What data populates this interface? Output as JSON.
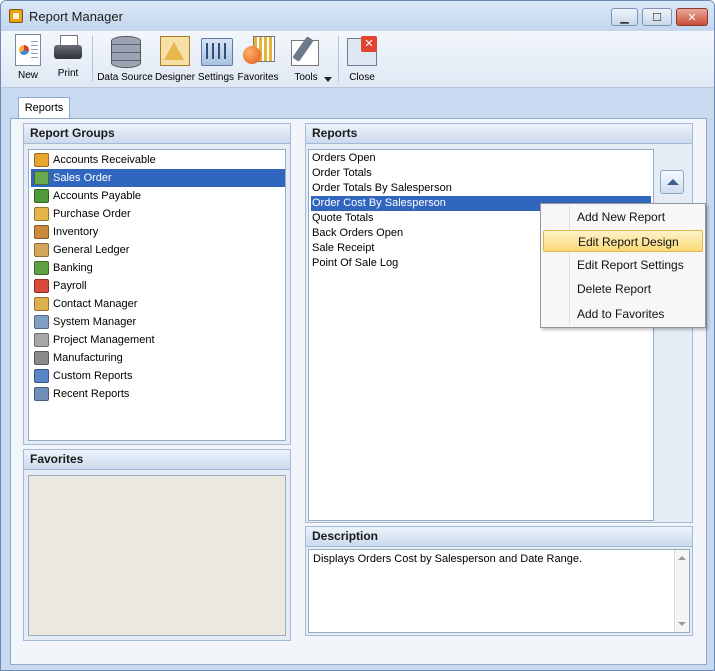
{
  "window": {
    "title": "Report Manager"
  },
  "toolbar": {
    "buttons": [
      {
        "label": "New",
        "icon": "new-report-icon"
      },
      {
        "label": "Print",
        "icon": "printer-icon"
      },
      {
        "label": "Data Source",
        "icon": "database-icon"
      },
      {
        "label": "Designer",
        "icon": "designer-icon"
      },
      {
        "label": "Settings",
        "icon": "settings-icon"
      },
      {
        "label": "Favorites",
        "icon": "favorites-icon"
      },
      {
        "label": "Tools",
        "icon": "tools-icon"
      },
      {
        "label": "Close",
        "icon": "close-window-icon"
      }
    ]
  },
  "tabs": [
    {
      "label": "Reports"
    }
  ],
  "report_groups": {
    "header": "Report Groups",
    "items": [
      {
        "label": "Accounts Receivable",
        "color": "#e8a62c"
      },
      {
        "label": "Sales Order",
        "color": "#6aa84f",
        "selected": true
      },
      {
        "label": "Accounts Payable",
        "color": "#4f9a3a"
      },
      {
        "label": "Purchase Order",
        "color": "#e5b54a"
      },
      {
        "label": "Inventory",
        "color": "#c98a3a"
      },
      {
        "label": "General Ledger",
        "color": "#d4a85a"
      },
      {
        "label": "Banking",
        "color": "#5f9f45"
      },
      {
        "label": "Payroll",
        "color": "#d84a3a"
      },
      {
        "label": "Contact Manager",
        "color": "#e0b050"
      },
      {
        "label": "System Manager",
        "color": "#7f9fc5"
      },
      {
        "label": "Project Management",
        "color": "#a8a8a8"
      },
      {
        "label": "Manufacturing",
        "color": "#8a8a8a"
      },
      {
        "label": "Custom Reports",
        "color": "#5a86c8"
      },
      {
        "label": "Recent Reports",
        "color": "#6f8fb8"
      }
    ]
  },
  "favorites": {
    "header": "Favorites"
  },
  "reports": {
    "header": "Reports",
    "items": [
      {
        "label": "Orders Open"
      },
      {
        "label": "Order Totals"
      },
      {
        "label": "Order Totals By Salesperson"
      },
      {
        "label": "Order Cost By Salesperson",
        "selected": true
      },
      {
        "label": "Quote Totals"
      },
      {
        "label": "Back Orders Open"
      },
      {
        "label": "Sale Receipt"
      },
      {
        "label": "Point Of Sale Log"
      }
    ]
  },
  "description": {
    "header": "Description",
    "text": "Displays Orders Cost by Salesperson and Date Range."
  },
  "context_menu": {
    "items": [
      {
        "label": "Add New Report"
      },
      {
        "label": "Edit Report Design",
        "hover": true
      },
      {
        "label": "Edit Report Settings"
      },
      {
        "label": "Delete Report"
      },
      {
        "label": "Add to Favorites"
      }
    ]
  },
  "colors": {
    "selection": "#3066be",
    "panel_border": "#a5bad6",
    "menu_hover": "#f9d877"
  }
}
